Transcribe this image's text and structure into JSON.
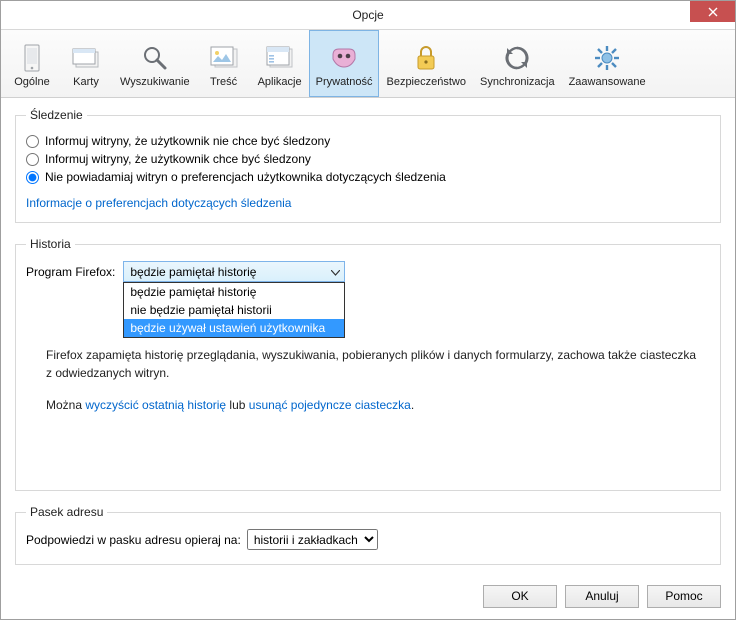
{
  "window": {
    "title": "Opcje"
  },
  "toolbar": {
    "items": [
      {
        "label": "Ogólne",
        "icon": "general"
      },
      {
        "label": "Karty",
        "icon": "tabs"
      },
      {
        "label": "Wyszukiwanie",
        "icon": "search"
      },
      {
        "label": "Treść",
        "icon": "content"
      },
      {
        "label": "Aplikacje",
        "icon": "applications"
      },
      {
        "label": "Prywatność",
        "icon": "privacy",
        "selected": true
      },
      {
        "label": "Bezpieczeństwo",
        "icon": "security"
      },
      {
        "label": "Synchronizacja",
        "icon": "sync"
      },
      {
        "label": "Zaawansowane",
        "icon": "advanced"
      }
    ]
  },
  "tracking": {
    "legend": "Śledzenie",
    "opt1": "Informuj witryny, że użytkownik nie chce być śledzony",
    "opt2": "Informuj witryny, że użytkownik chce być śledzony",
    "opt3": "Nie powiadamiaj witryn o preferencjach użytkownika dotyczących śledzenia",
    "link": "Informacje o preferencjach dotyczących śledzenia"
  },
  "history": {
    "legend": "Historia",
    "program_label": "Program Firefox:",
    "selected": "będzie pamiętał historię",
    "options": [
      "będzie pamiętał historię",
      "nie będzie pamiętał historii",
      "będzie używał ustawień użytkownika"
    ],
    "desc": "Firefox zapamięta historię przeglądania, wyszukiwania, pobieranych plików i danych formularzy, zachowa także ciasteczka z odwiedzanych witryn.",
    "links_prefix": "Można ",
    "link1": "wyczyścić ostatnią historię",
    "links_mid": " lub ",
    "link2": "usunąć pojedyncze ciasteczka",
    "links_suffix": "."
  },
  "addressbar": {
    "legend": "Pasek adresu",
    "label": "Podpowiedzi w pasku adresu opieraj na:",
    "value": "historii i zakładkach"
  },
  "footer": {
    "ok": "OK",
    "cancel": "Anuluj",
    "help": "Pomoc"
  }
}
